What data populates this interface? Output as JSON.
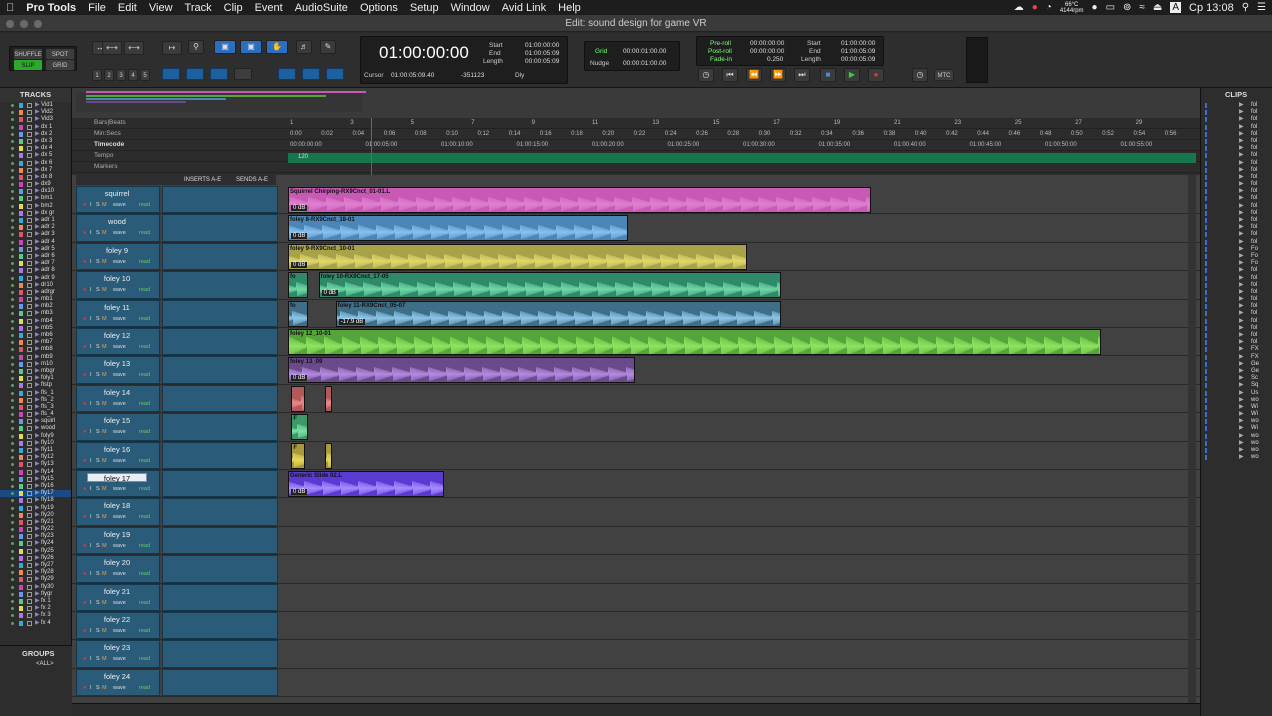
{
  "menubar": {
    "apple": "",
    "app": "Pro Tools",
    "items": [
      "File",
      "Edit",
      "View",
      "Track",
      "Clip",
      "Event",
      "AudioSuite",
      "Options",
      "Setup",
      "Window",
      "Avid Link",
      "Help"
    ],
    "status": {
      "temp": "66°C",
      "rpm": "4144rpm",
      "clock": "Ср 13:08"
    }
  },
  "window": {
    "title": "Edit: sound design for game VR"
  },
  "toolbar": {
    "modes": {
      "shuffle": "SHUFFLE",
      "spot": "SPOT",
      "slip": "SLIP",
      "grid": "GRID"
    },
    "zoom_presets": [
      "1",
      "2",
      "3",
      "4",
      "5"
    ],
    "main_counter": "01:00:00:00",
    "cursor_label": "Cursor",
    "cursor_value": "01:00:05:09.40",
    "sample_value": "-351123",
    "dly_label": "Dly",
    "sel": {
      "start_label": "Start",
      "end_label": "End",
      "length_label": "Length",
      "start": "01:00:00:00",
      "end": "01:00:05:09",
      "length": "00:00:05:09"
    },
    "grid": {
      "grid_label": "Grid",
      "grid_value": "00:00:01:00.00",
      "nudge_label": "Nudge",
      "nudge_value": "00:00:01:00.00"
    },
    "pre": {
      "preroll_label": "Pre-roll",
      "postroll_label": "Post-roll",
      "fadein_label": "Fade-in",
      "preroll": "00:00:00:00",
      "postroll": "00:00:00:00",
      "fadein": "0.250"
    },
    "transport_sel": {
      "start": "01:00:00:00",
      "end": "01:00:05:09",
      "length": "00:00:05:09"
    },
    "mtc": "MTC"
  },
  "panels": {
    "tracks_title": "TRACKS",
    "groups_title": "GROUPS",
    "groups_item": "<ALL>",
    "clips_title": "CLIPS"
  },
  "track_list": [
    "Vid1",
    "Vid2",
    "Vid3",
    "dx 1",
    "dx 2",
    "dx 3",
    "dx 4",
    "dx 5",
    "dx 6",
    "dx 7",
    "dx 8",
    "dx9",
    "dx10",
    "bm1",
    "bm2",
    "dx gr",
    "adr 1",
    "adr 2",
    "adr 3",
    "adr 4",
    "adr 5",
    "adr 6",
    "adr 7",
    "adr 8",
    "adr 9",
    "dr10",
    "adrgr",
    "mb1",
    "mb2",
    "mb3",
    "mb4",
    "mb5",
    "mb6",
    "mb7",
    "mb8",
    "mb9",
    "m10",
    "mbgr",
    "foly1",
    "flstp",
    "fls_1",
    "fls_2",
    "fls_3",
    "fls_4",
    "squirl",
    "wood",
    "foly9",
    "fly10",
    "fly11",
    "fly12",
    "fly13",
    "fly14",
    "fly15",
    "fly16",
    "fly17",
    "fly18",
    "fly19",
    "fly20",
    "fly21",
    "fly22",
    "fly23",
    "fly24",
    "fly25",
    "fly26",
    "fly27",
    "fly28",
    "fly29",
    "fly30",
    "flygr",
    "fx 1",
    "fx 2",
    "fx 3",
    "fx 4"
  ],
  "rulers": {
    "bars_label": "Bars|Beats",
    "minsecs_label": "Min:Secs",
    "timecode_label": "Timecode",
    "tempo_label": "Tempo",
    "markers_label": "Markers",
    "tempo_value": "120",
    "bars": [
      "1",
      "3",
      "5",
      "7",
      "9",
      "11",
      "13",
      "15",
      "17",
      "19",
      "21",
      "23",
      "25",
      "27",
      "29"
    ],
    "minsecs": [
      "0:00",
      "0:02",
      "0:04",
      "0:06",
      "0:08",
      "0:10",
      "0:12",
      "0:14",
      "0:16",
      "0:18",
      "0:20",
      "0:22",
      "0:24",
      "0:26",
      "0:28",
      "0:30",
      "0:32",
      "0:34",
      "0:36",
      "0:38",
      "0:40",
      "0:42",
      "0:44",
      "0:46",
      "0:48",
      "0:50",
      "0:52",
      "0:54",
      "0:56"
    ],
    "timecode": [
      "00:00:00:00",
      "01:00:05:00",
      "01:00:10:00",
      "01:00:15:00",
      "01:00:20:00",
      "01:00:25:00",
      "01:00:30:00",
      "01:00:35:00",
      "01:00:40:00",
      "01:00:45:00",
      "01:00:50:00",
      "01:00:55:00"
    ]
  },
  "columns": {
    "inserts": "INSERTS A-E",
    "sends": "SENDS A-E"
  },
  "tracks": [
    {
      "name": "squirrel",
      "mode": "wave",
      "auto": "read",
      "clips": [
        {
          "name": "Squirrel Chirping-RX9Cnct_01-01.L",
          "vol": "0 dB",
          "color": "#c85ab5",
          "wave": "#e080d0",
          "start": 0,
          "end": 0.343
        }
      ]
    },
    {
      "name": "wood",
      "mode": "wave",
      "auto": "read",
      "clips": [
        {
          "name": "foley 8-RX9Cnct_18-01",
          "vol": "0 dB",
          "color": "#4c86b8",
          "wave": "#88c0ef",
          "start": 0,
          "end": 0.2
        }
      ]
    },
    {
      "name": "foley 9",
      "mode": "wave",
      "auto": "read",
      "clips": [
        {
          "name": "foley 9-RX9Cnct_10-01",
          "vol": "0 dB",
          "color": "#a8a24a",
          "wave": "#e0d86a",
          "start": 0,
          "end": 0.27
        }
      ]
    },
    {
      "name": "foley 10",
      "mode": "wave",
      "auto": "read",
      "clips": [
        {
          "name": "fo",
          "vol": "",
          "color": "#2e8a6b",
          "wave": "#6fd8a6",
          "start": 0,
          "end": 0.012
        },
        {
          "name": "foley 10-RX9Cnct_17-05",
          "vol": "0 dB",
          "color": "#2e8a6b",
          "wave": "#6fd8a6",
          "start": 0.018,
          "end": 0.29
        }
      ]
    },
    {
      "name": "foley 11",
      "mode": "wave",
      "auto": "read",
      "clips": [
        {
          "name": "fo",
          "vol": "",
          "color": "#3e6e88",
          "wave": "#8cc6e8",
          "start": 0,
          "end": 0.012
        },
        {
          "name": "foley 11-RX9Cnct_05-07",
          "vol": "-17.9 dB",
          "color": "#3e6e88",
          "wave": "#8cc6e8",
          "start": 0.028,
          "end": 0.29
        }
      ]
    },
    {
      "name": "foley 12",
      "mode": "wave",
      "auto": "read",
      "clips": [
        {
          "name": "foley 12_10-01",
          "vol": "",
          "color": "#55a53a",
          "wave": "#8fe45f",
          "start": 0,
          "end": 0.478
        }
      ]
    },
    {
      "name": "foley 13",
      "mode": "wave",
      "auto": "read",
      "clips": [
        {
          "name": "foley 13_09",
          "vol": "0 dB",
          "color": "#6a4a8a",
          "wave": "#b48ae0",
          "start": 0,
          "end": 0.204
        }
      ]
    },
    {
      "name": "foley 14",
      "mode": "wave",
      "auto": "read",
      "clips": [
        {
          "name": "",
          "vol": "",
          "color": "#b25a5a",
          "wave": "#e88a8a",
          "start": 0.002,
          "end": 0.01
        },
        {
          "name": "",
          "vol": "",
          "color": "#b25a5a",
          "wave": "#e88a8a",
          "start": 0.022,
          "end": 0.026
        }
      ]
    },
    {
      "name": "foley 15",
      "mode": "wave",
      "auto": "read",
      "clips": [
        {
          "name": "F",
          "vol": "",
          "color": "#3c9a6a",
          "wave": "#7be0a8",
          "start": 0.002,
          "end": 0.012
        }
      ]
    },
    {
      "name": "foley 16",
      "mode": "wave",
      "auto": "read",
      "clips": [
        {
          "name": "F",
          "vol": "",
          "color": "#a89a3a",
          "wave": "#e8d85a",
          "start": 0.002,
          "end": 0.01
        },
        {
          "name": "",
          "vol": "",
          "color": "#a89a3a",
          "wave": "#e8d85a",
          "start": 0.022,
          "end": 0.026
        }
      ]
    },
    {
      "name": "foley 17",
      "mode": "wave",
      "auto": "read",
      "selected": true,
      "clips": [
        {
          "name": "Generic Slide 02.L",
          "vol": "0 dB",
          "color": "#5a3ad0",
          "wave": "#a88aff",
          "start": 0,
          "end": 0.092
        }
      ]
    },
    {
      "name": "foley 18",
      "mode": "wave",
      "auto": "read",
      "clips": []
    },
    {
      "name": "foley 19",
      "mode": "wave",
      "auto": "read",
      "clips": []
    },
    {
      "name": "foley 20",
      "mode": "wave",
      "auto": "read",
      "clips": []
    },
    {
      "name": "foley 21",
      "mode": "wave",
      "auto": "read",
      "clips": []
    },
    {
      "name": "foley 22",
      "mode": "wave",
      "auto": "read",
      "clips": []
    },
    {
      "name": "foley 23",
      "mode": "wave",
      "auto": "read",
      "clips": []
    },
    {
      "name": "foley 24",
      "mode": "wave",
      "auto": "read",
      "clips": []
    }
  ],
  "clip_list": [
    "fol",
    "fol",
    "fol",
    "fol",
    "fol",
    "fol",
    "fol",
    "fol",
    "fol",
    "fol",
    "fol",
    "fol",
    "fol",
    "fol",
    "fol",
    "fol",
    "fol",
    "fol",
    "fol",
    "fol",
    "Fo",
    "Fo",
    "Fo",
    "fol",
    "fol",
    "fol",
    "fol",
    "fol",
    "fol",
    "fol",
    "fol",
    "fol",
    "fol",
    "fol",
    "FX",
    "FX",
    "Ge",
    "Ge",
    "Sc",
    "Sq",
    "Us",
    "wo",
    "Wi",
    "Wi",
    "wo",
    "Wi",
    "wo",
    "wo",
    "wo",
    "wo"
  ],
  "colors": {
    "accent": "#2da82d",
    "track_header": "#2a5c7a",
    "selection": "#1a4a84",
    "cursor": "#cc3a3a",
    "tempo": "#16764c"
  }
}
